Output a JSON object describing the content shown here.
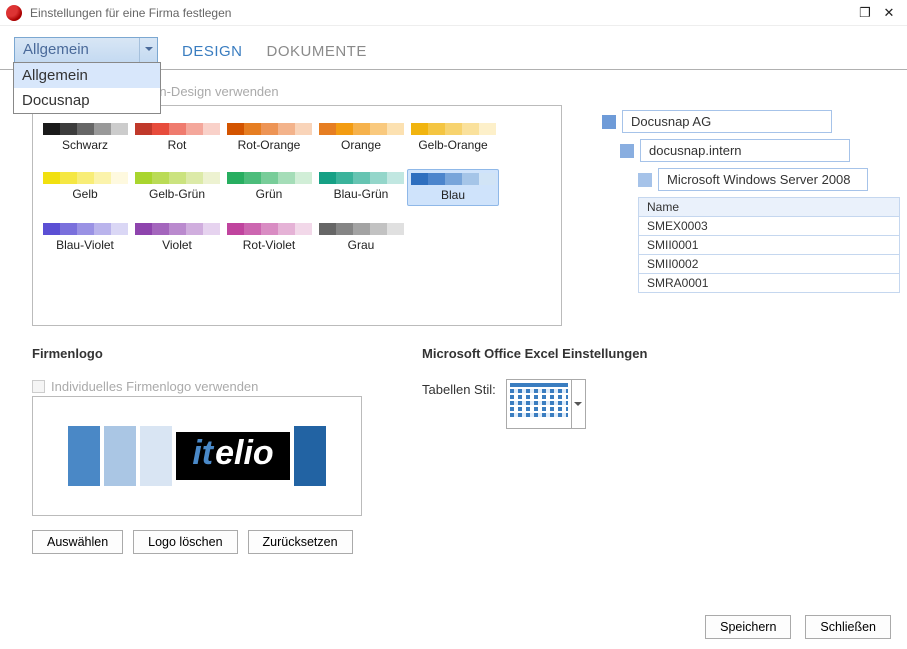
{
  "window": {
    "title": "Einstellungen für eine Firma festlegen"
  },
  "dropdown": {
    "value": "Allgemein",
    "options": [
      "Allgemein",
      "Docusnap"
    ]
  },
  "tabs": {
    "design": "DESIGN",
    "dokumente": "DOKUMENTE"
  },
  "palette": {
    "checkbox_label": "Individuelles Firmen-Design verwenden",
    "selected": "Blau",
    "items": [
      {
        "name": "Schwarz",
        "colors": [
          "#1a1a1a",
          "#3c3c3c",
          "#666",
          "#999",
          "#ccc"
        ]
      },
      {
        "name": "Rot",
        "colors": [
          "#c0392b",
          "#e74c3c",
          "#ef7b6e",
          "#f4a79b",
          "#f9d1c9"
        ]
      },
      {
        "name": "Rot-Orange",
        "colors": [
          "#d35400",
          "#e67e22",
          "#ed9455",
          "#f3b38b",
          "#f9d4b9"
        ]
      },
      {
        "name": "Orange",
        "colors": [
          "#e67e22",
          "#f39c12",
          "#f6b24c",
          "#f9c97e",
          "#fce1b1"
        ]
      },
      {
        "name": "Gelb-Orange",
        "colors": [
          "#f1b40f",
          "#f4c542",
          "#f7d36f",
          "#fae19c",
          "#fdf0ca"
        ]
      },
      {
        "name": "Gelb",
        "colors": [
          "#f1e00f",
          "#f5e743",
          "#f8ed77",
          "#fbf3ab",
          "#fef9df"
        ]
      },
      {
        "name": "Gelb-Grün",
        "colors": [
          "#a9d52e",
          "#badb56",
          "#cbe37f",
          "#dceaa8",
          "#edf2d1"
        ]
      },
      {
        "name": "Grün",
        "colors": [
          "#27ae60",
          "#4cbd7b",
          "#78cd99",
          "#a5ddb8",
          "#d1eed7"
        ]
      },
      {
        "name": "Blau-Grün",
        "colors": [
          "#16a085",
          "#3bb39b",
          "#66c4b2",
          "#94d6ca",
          "#c1e7e1"
        ]
      },
      {
        "name": "Blau",
        "colors": [
          "#2e6fbf",
          "#4c85cc",
          "#78a5da",
          "#a5c5e8",
          "#d1e4f6"
        ]
      },
      {
        "name": "Blau-Violet",
        "colors": [
          "#5b4fd4",
          "#7a70dc",
          "#9a92e4",
          "#bab4ec",
          "#dad7f5"
        ]
      },
      {
        "name": "Violet",
        "colors": [
          "#8e44ad",
          "#a466bd",
          "#ba8ace",
          "#d0aede",
          "#e6d3ef"
        ]
      },
      {
        "name": "Rot-Violet",
        "colors": [
          "#c0449e",
          "#cc66b0",
          "#d98cc3",
          "#e5b2d6",
          "#f2d8e9"
        ]
      },
      {
        "name": "Grau",
        "colors": [
          "#666",
          "#858585",
          "#a3a3a3",
          "#c2c2c2",
          "#e0e0e0"
        ]
      }
    ]
  },
  "tree": {
    "company": "Docusnap AG",
    "domain": "docusnap.intern",
    "os": "Microsoft Windows Server 2008",
    "table_header": "Name",
    "rows": [
      "SMEX0003",
      "SMII0001",
      "SMII0002",
      "SMRA0001"
    ]
  },
  "logo": {
    "heading": "Firmenlogo",
    "checkbox_label": "Individuelles Firmenlogo verwenden",
    "buttons": {
      "choose": "Auswählen",
      "delete": "Logo löschen",
      "reset": "Zurücksetzen"
    }
  },
  "excel": {
    "heading": "Microsoft Office Excel Einstellungen",
    "label": "Tabellen Stil:"
  },
  "footer": {
    "save": "Speichern",
    "close": "Schließen"
  }
}
